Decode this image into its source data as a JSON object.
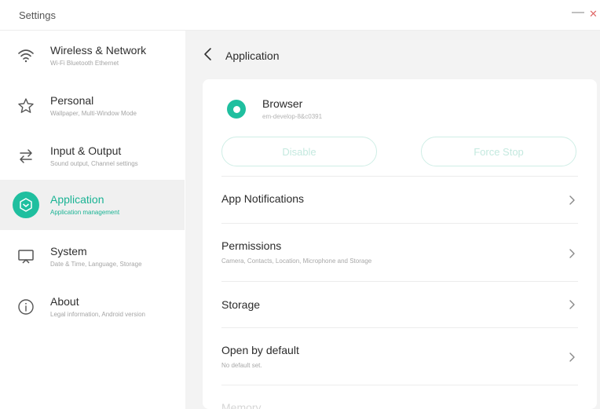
{
  "window": {
    "title": "Settings",
    "minimize_glyph": "—",
    "close_glyph": "✕"
  },
  "sidebar": {
    "items": [
      {
        "title": "Wireless & Network",
        "subtitle": "Wi-Fi Bluetooth Ethernet",
        "icon": "wifi-icon",
        "active": false
      },
      {
        "title": "Personal",
        "subtitle": "Wallpaper, Multi-Window Mode",
        "icon": "star-icon",
        "active": false
      },
      {
        "title": "Input & Output",
        "subtitle": "Sound output, Channel settings",
        "icon": "arrows-icon",
        "active": false
      },
      {
        "title": "Application",
        "subtitle": "Application management",
        "icon": "application-icon",
        "active": true
      },
      {
        "title": "System",
        "subtitle": "Date & Time, Language, Storage",
        "icon": "monitor-icon",
        "active": false
      },
      {
        "title": "About",
        "subtitle": "Legal information, Android version",
        "icon": "info-icon",
        "active": false
      }
    ]
  },
  "header": {
    "title": "Application"
  },
  "app": {
    "name": "Browser",
    "package": "em-develop-8&c0391",
    "disable_label": "Disable",
    "force_stop_label": "Force Stop"
  },
  "rows": [
    {
      "title": "App Notifications",
      "subtitle": ""
    },
    {
      "title": "Permissions",
      "subtitle": "Camera, Contacts, Location, Microphone and Storage"
    },
    {
      "title": "Storage",
      "subtitle": ""
    },
    {
      "title": "Open by default",
      "subtitle": "No default set."
    },
    {
      "title": "Memory",
      "subtitle": ""
    }
  ],
  "colors": {
    "accent": "#1fbf9f",
    "active_bg": "#f0f0f0",
    "main_bg": "#f3f3f3"
  }
}
